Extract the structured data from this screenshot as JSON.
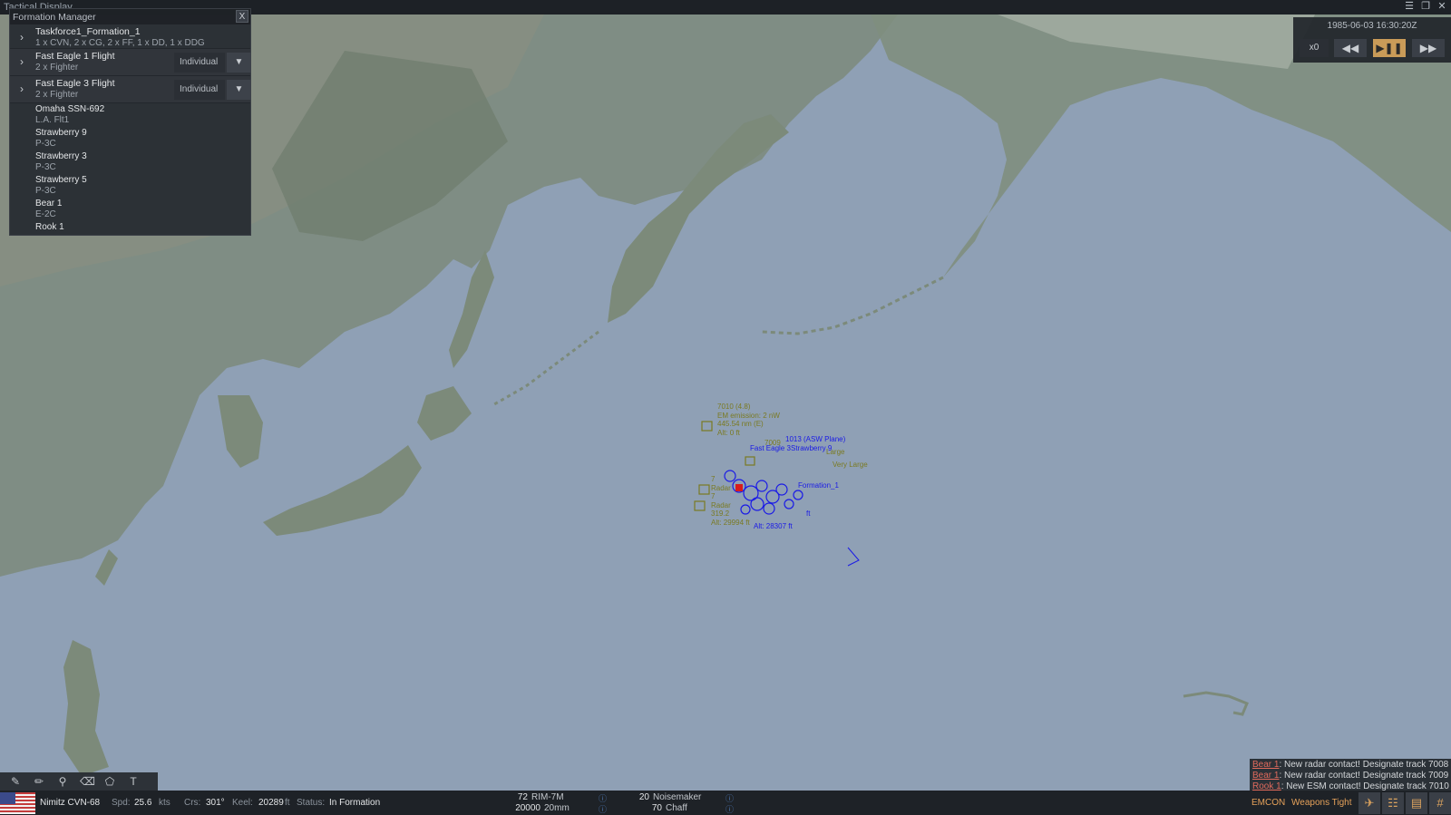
{
  "window": {
    "title": "Tactical Display",
    "menu_icon": "hamburger-icon",
    "restore_icon": "restore-icon",
    "close_icon": "close-icon"
  },
  "formation_manager": {
    "title": "Formation Manager",
    "close_label": "X",
    "groups": [
      {
        "name": "Taskforce1_Formation_1",
        "detail": "1 x CVN, 2 x CG, 2 x FF, 1 x DD, 1 x DDG"
      },
      {
        "name": "Fast Eagle 1 Flight",
        "detail": "2 x Fighter",
        "mode": "Individual"
      },
      {
        "name": "Fast Eagle 3 Flight",
        "detail": "2 x Fighter",
        "mode": "Individual"
      }
    ],
    "units": [
      {
        "name": "Omaha SSN-692",
        "detail": "L.A. Flt1"
      },
      {
        "name": "Strawberry 9",
        "detail": "P-3C"
      },
      {
        "name": "Strawberry 3",
        "detail": "P-3C"
      },
      {
        "name": "Strawberry 5",
        "detail": "P-3C"
      },
      {
        "name": "Bear 1",
        "detail": "E-2C"
      },
      {
        "name": "Rook 1",
        "detail": ""
      }
    ]
  },
  "time_control": {
    "datetime": "1985-06-03 16:30:20Z",
    "speed": "x0",
    "rewind_icon": "rewind-icon",
    "play_pause_icon": "play-pause-icon",
    "fast_forward_icon": "fast-forward-icon"
  },
  "map_labels": {
    "track_7010": [
      "7010  (4.8)",
      "EM emission: 2 nW",
      "445.54 nm (E)",
      "Alt: 0 ft"
    ],
    "asw_plane": "1013 (ASW Plane)",
    "fast_eagle": "Fast Eagle 3",
    "strawberry": "Strawberry 9",
    "very_large": "Very Large",
    "large": "Large",
    "formation": "Formation_1",
    "cluster_left": [
      "7",
      "Radar",
      "7",
      "Radar",
      "319.2",
      "Alt: 29994 ft"
    ],
    "alt_blue": "Alt: 28307 ft",
    "alt_blue2": "ft",
    "track_7009": "7009"
  },
  "messages": [
    {
      "who": "Bear 1",
      "text": ": New radar contact! Designate track 7008"
    },
    {
      "who": "Bear 1",
      "text": ": New radar contact! Designate track 7009"
    },
    {
      "who": "Rook 1",
      "text": ": New ESM contact! Designate track 7010"
    }
  ],
  "status": {
    "unit": "Nimitz CVN-68",
    "spd_label": "Spd:",
    "spd": "25.6",
    "spd_unit": "kts",
    "crs_label": "Crs:",
    "crs": "301°",
    "keel_label": "Keel:",
    "keel": "20289",
    "keel_unit": "ft",
    "status_label": "Status:",
    "status": "In Formation",
    "weapons": [
      {
        "qty": "72",
        "name": "RIM-7M"
      },
      {
        "qty": "20000",
        "name": "20mm"
      },
      {
        "qty": "20",
        "name": "Noisemaker"
      },
      {
        "qty": "70",
        "name": "Chaff"
      }
    ],
    "emcon": "EMCON",
    "weapons_state": "Weapons Tight"
  },
  "colors": {
    "ocean": "#8fa0b5",
    "friendly": "#1a1ae6",
    "unknown": "#7a7a22",
    "hostile": "#d81c1c",
    "accent": "#c99b58"
  }
}
